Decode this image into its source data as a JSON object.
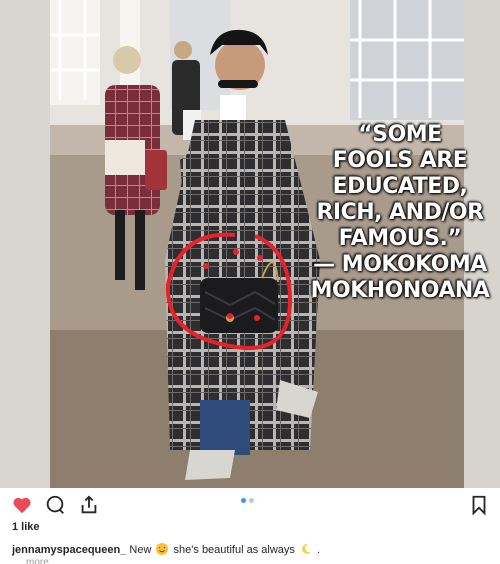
{
  "post": {
    "quote_lines": [
      "“SOME",
      "FOOLS ARE",
      "EDUCATED,",
      "RICH, AND/OR",
      "FAMOUS.”",
      "— MOKOKOMA",
      "MOKHONOANA"
    ],
    "likes": "1 like",
    "caption": {
      "username": "jennamyspacequeen_",
      "text_before_emoji": "New",
      "text_after_emoji": "she's beautiful as always",
      "trailing": "."
    },
    "more_label": "more"
  },
  "icons": {
    "like": "heart-icon",
    "comment": "comment-icon",
    "share": "share-icon",
    "save": "bookmark-icon",
    "emoji_1": "heart-eyes-emoji",
    "emoji_2": "crescent-moon-emoji"
  },
  "colors": {
    "heart": "#ed4956",
    "active_dot": "#3897f0",
    "annotation_circle": "#e8222a"
  },
  "carousel": {
    "current": 1,
    "total": 2
  }
}
